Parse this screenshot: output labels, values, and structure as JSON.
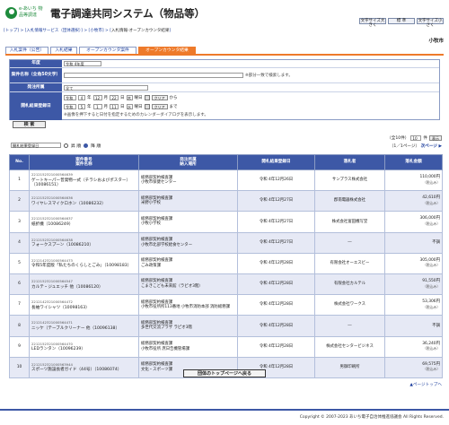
{
  "header": {
    "logo_text": "e-あいち 物品等調達",
    "system_title": "電子調達共同システム（物品等）",
    "toolbar": {
      "text_size": "文字サイズ大きく",
      "standard": "標 準",
      "text_size_small": "文字サイズ小さく"
    }
  },
  "breadcrumb": {
    "items": [
      "トップ",
      "入札情報サービス（団体選択）",
      "小牧市",
      "入札情報-オープンカウンタ結果"
    ],
    "separator": " > "
  },
  "organization": "小牧市",
  "tabs": [
    {
      "label": "入札案件（公告）",
      "active": false
    },
    {
      "label": "入札結果",
      "active": false
    },
    {
      "label": "オープンカウンタ案件",
      "active": false
    },
    {
      "label": "オープンカウンタ結果",
      "active": true
    }
  ],
  "form": {
    "year_label": "年度",
    "year_value": "令和 4年度",
    "project_name_label": "案件名称（全角50文字）",
    "project_name_note": "※部分一致で検索します。",
    "dept_label": "発注所属",
    "dept_value": "全て",
    "date_label": "開札結果登録日",
    "date_from": {
      "era": "令和",
      "year": "4",
      "month": "12",
      "day": "22",
      "weekday": "木",
      "suffix": "曜日",
      "clear": "クリア",
      "range": "から"
    },
    "date_to": {
      "era": "令和",
      "year": "5",
      "month": "1",
      "day": "11",
      "weekday": "水",
      "suffix": "曜日",
      "clear": "クリア",
      "range": "まで"
    },
    "date_note": "※画像を押下すると日付を指定するためのカレンダーダイアログを表示します。",
    "units": {
      "year": "年",
      "month": "月",
      "day": "日"
    },
    "search_button": "検 索"
  },
  "sort": {
    "selected": "開札結果登録日",
    "asc": "昇 順",
    "desc": "降 順",
    "desc_selected": true
  },
  "results": {
    "total": "（全10件）",
    "per_page": "10",
    "per_page_suffix": "件",
    "display": "表示",
    "page_info": "（1／1ページ）",
    "next": "次ページ ▶"
  },
  "table": {
    "headers": [
      "No.",
      "案件番号\n案件名称",
      "発注所属\n納入場所",
      "開札結果登録日",
      "落札者",
      "落札金額"
    ],
    "tax_note": "（税込み）",
    "rows": [
      {
        "no": "1",
        "id": "2212152321000564639",
        "name": "ゲートキーパー普発物一式（チラシおよびポスター）（10086151）",
        "dept": "総務部契約検査課",
        "place": "小牧市保健センター",
        "date": "令和 4年12月26日",
        "winner": "サンプラス株式会社",
        "amount": "110,000円"
      },
      {
        "no": "2",
        "id": "2212152321000564636",
        "name": "ワイヤレスマイクロホン（10086232）",
        "dept": "総務部契約検査課",
        "place": "米野小学校",
        "date": "令和 4年12月27日",
        "winner": "郡南電器株式会社",
        "amount": "42,610円"
      },
      {
        "no": "3",
        "id": "2212152321000564637",
        "name": "紙折機（10086249）",
        "dept": "総務部契約検査課",
        "place": "小牧小学校",
        "date": "令和 4年12月27日",
        "winner": "株式会社富田機写堂",
        "amount": "306,000円"
      },
      {
        "no": "4",
        "id": "2212152321000564638",
        "name": "フォークスプーン（10086210）",
        "dept": "総務部契約検査課",
        "place": "小牧市北部学校給食センター",
        "date": "令和 4年12月27日",
        "winner": "―",
        "amount": "不調"
      },
      {
        "no": "5",
        "id": "2212142321000564473",
        "name": "令和5年度版「私たちのくらしとごみ」（10098183）",
        "dept": "総務部契約検査課",
        "place": "ごみ政策課",
        "date": "令和 4年12月28日",
        "winner": "有限会社オーエスビー",
        "amount": "305,000円"
      },
      {
        "no": "6",
        "id": "2212152321000564547",
        "name": "カルテ・ジュエッチ 他（10086120）",
        "dept": "総務部契約検査課",
        "place": "こまきこども未来館（ラピオ3階）",
        "date": "令和 4年12月28日",
        "winner": "有限会社カルテル",
        "amount": "91,550円"
      },
      {
        "no": "7",
        "id": "2212142321000564472",
        "name": "長袖ワイシャツ（10098163）",
        "dept": "総務部契約検査課",
        "place": "小牧市役所所113番地 小牧市消防本部 消防総務課",
        "date": "令和 4年12月28日",
        "winner": "株式会社ワークス",
        "amount": "53,306円"
      },
      {
        "no": "8",
        "id": "2212142321000564471",
        "name": "ニッケ（テーブルクリーナー 他（10096138）",
        "dept": "総務部契約検査課",
        "place": "多世代交流プラザ ラピオ3階",
        "date": "令和 4年12月28日",
        "winner": "―",
        "amount": "不調"
      },
      {
        "no": "9",
        "id": "2212152321000564470",
        "name": "LEDランタン（10096239）",
        "dept": "総務部契約検査課",
        "place": "小牧市役所 庶日告機管場課",
        "date": "令和 4年12月28日",
        "winner": "株式会社センタービジネス",
        "amount": "36,240円"
      },
      {
        "no": "10",
        "id": "2212152321000563944",
        "name": "スポーツ施設長者ガイド（44号）（10086074）",
        "dept": "総務部契約検査課",
        "place": "文化・スポーツ課",
        "date": "令和 4年12月28日",
        "winner": "男御印刷所",
        "amount": "69,575円"
      }
    ]
  },
  "footer": {
    "back_button": "団体のトップページへ戻る",
    "page_top": "▲ページトップへ",
    "copyright": "Copyright © 2007-2023 あいち電子自治体推進協議会 All Rights Reserved."
  }
}
